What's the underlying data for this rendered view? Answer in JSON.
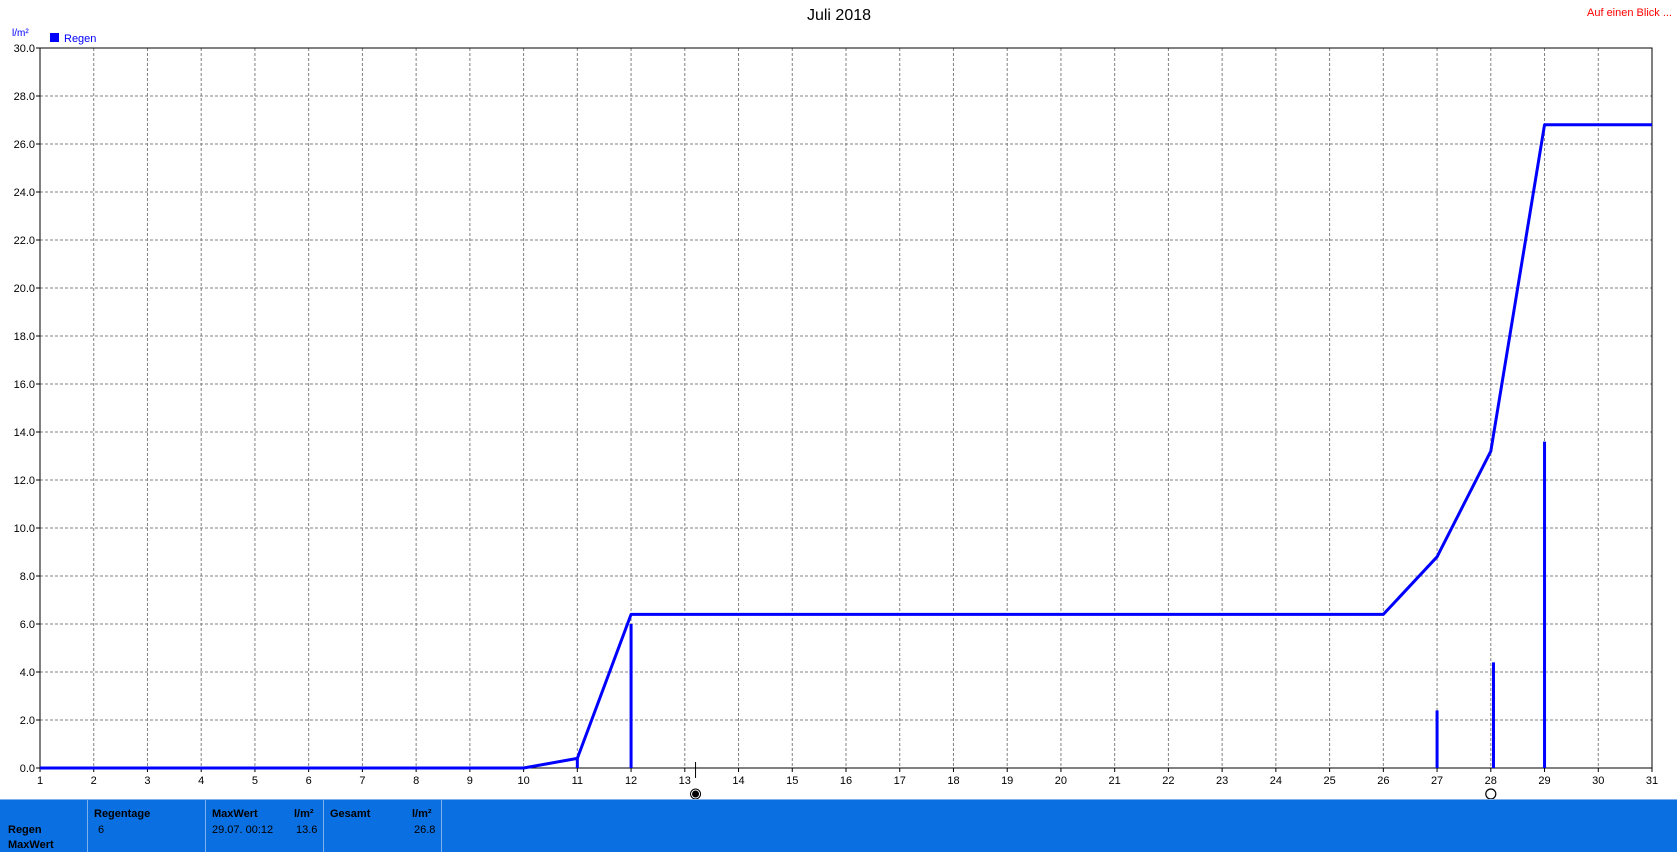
{
  "header": {
    "title": "Juli 2018",
    "link_label": "Auf einen Blick ..."
  },
  "colors": {
    "series": "#0000ff",
    "grid": "#808080",
    "panel_bg": "#0a6fe0",
    "link": "#ff0000"
  },
  "chart_data": {
    "type": "line",
    "title": "Juli 2018",
    "y_unit": "l/m²",
    "ylim": [
      0,
      30
    ],
    "xlim": [
      1,
      31
    ],
    "y_ticks": [
      "0.0",
      "2.0",
      "4.0",
      "6.0",
      "8.0",
      "10.0",
      "12.0",
      "14.0",
      "16.0",
      "18.0",
      "20.0",
      "22.0",
      "24.0",
      "26.0",
      "28.0",
      "30.0"
    ],
    "x_ticks": [
      "1",
      "2",
      "3",
      "4",
      "5",
      "6",
      "7",
      "8",
      "9",
      "10",
      "11",
      "12",
      "13",
      "14",
      "15",
      "16",
      "17",
      "18",
      "19",
      "20",
      "21",
      "22",
      "23",
      "24",
      "25",
      "26",
      "27",
      "28",
      "29",
      "30",
      "31"
    ],
    "grid": true,
    "legend": "top-left",
    "legend_entries": [
      "Regen"
    ],
    "series": [
      {
        "name": "Regen",
        "kind": "cumulative-line",
        "points": [
          [
            1,
            0
          ],
          [
            10,
            0
          ],
          [
            11,
            0.4
          ],
          [
            12,
            6.4
          ],
          [
            26,
            6.4
          ],
          [
            27,
            8.8
          ],
          [
            28,
            13.2
          ],
          [
            29,
            26.8
          ],
          [
            31,
            26.8
          ]
        ]
      },
      {
        "name": "Regen",
        "kind": "daily-bars",
        "points": [
          [
            11,
            0.4
          ],
          [
            12,
            6.0
          ],
          [
            27,
            2.4
          ],
          [
            28.05,
            4.4
          ],
          [
            29,
            13.6
          ]
        ]
      }
    ],
    "moon_markers": [
      {
        "x": 13.2,
        "phase": "new-moon"
      },
      {
        "x": 28.0,
        "phase": "full-moon"
      }
    ],
    "cursor_x": 13.2
  },
  "stats": {
    "row_labels": [
      "Regen",
      "MaxWert"
    ],
    "regentage": {
      "header": "Regentage",
      "value": "6"
    },
    "maxwert": {
      "header": "MaxWert",
      "unit": "l/m²",
      "datetime": "29.07.  00:12",
      "value": "13.6"
    },
    "gesamt": {
      "header": "Gesamt",
      "unit": "l/m²",
      "value": "26.8"
    }
  }
}
